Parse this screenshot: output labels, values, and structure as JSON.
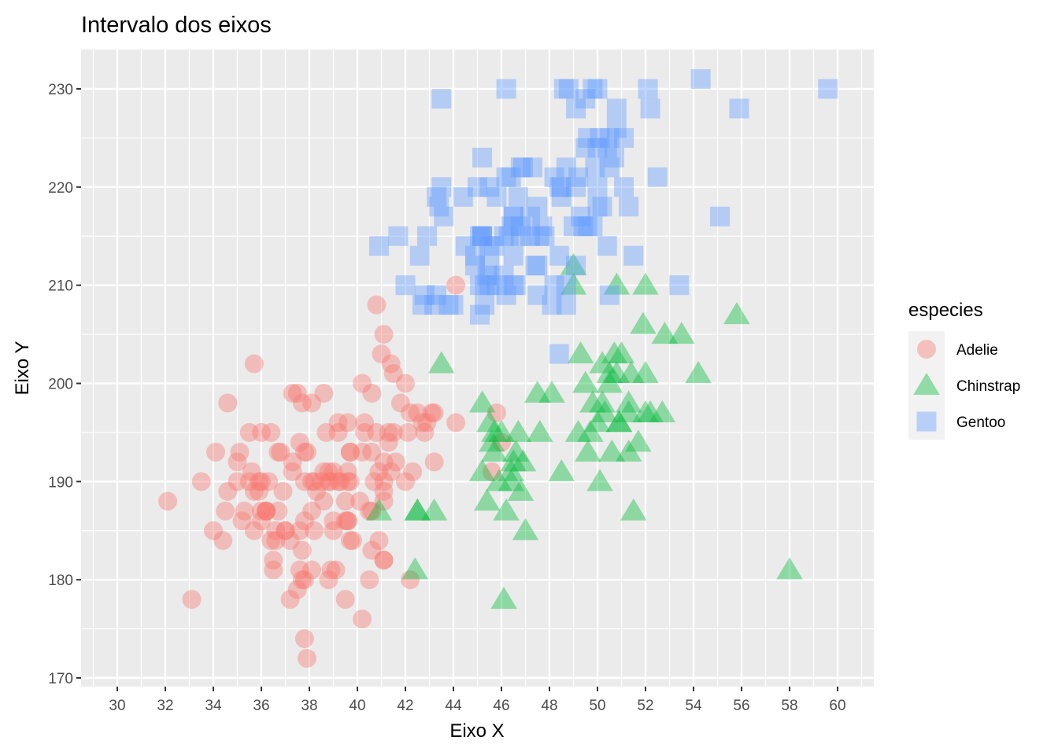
{
  "chart_data": {
    "type": "scatter",
    "title": "Intervalo dos eixos",
    "xlabel": "Eixo X",
    "ylabel": "Eixo Y",
    "xlim": [
      29,
      61
    ],
    "ylim": [
      169.4,
      234
    ],
    "x_ticks": [
      30,
      32,
      34,
      36,
      38,
      40,
      42,
      44,
      46,
      48,
      50,
      52,
      54,
      56,
      58,
      60
    ],
    "x_tick_labels": [
      "30",
      "32",
      "34",
      "36",
      "38",
      "40",
      "42",
      "44",
      "46",
      "48",
      "50",
      "52",
      "54",
      "56",
      "58",
      "60"
    ],
    "y_ticks": [
      170,
      180,
      190,
      200,
      210,
      220,
      230
    ],
    "y_tick_labels": [
      "170",
      "180",
      "190",
      "200",
      "210",
      "220",
      "230"
    ],
    "grid": true,
    "legend": {
      "title": "especies",
      "position": "right",
      "entries": [
        {
          "label": "Adelie",
          "shape": "circle",
          "color": "#F8766D"
        },
        {
          "label": "Chinstrap",
          "shape": "triangle",
          "color": "#00BA38"
        },
        {
          "label": "Gentoo",
          "shape": "square",
          "color": "#619CFF"
        }
      ]
    },
    "alpha": 0.4,
    "series": [
      {
        "name": "Adelie",
        "shape": "circle",
        "color": "#F8766D",
        "x": [
          39.1,
          39.5,
          40.3,
          36.7,
          39.3,
          38.9,
          39.2,
          34.1,
          42,
          37.8,
          37.8,
          41.1,
          38.6,
          34.6,
          36.6,
          38.7,
          42.5,
          34.4,
          46,
          37.8,
          37.7,
          35.9,
          38.2,
          38.8,
          35.3,
          40.6,
          40.5,
          37.9,
          40.5,
          39.5,
          37.2,
          39.5,
          40.9,
          36.4,
          39.2,
          38.8,
          42.2,
          37.6,
          39.8,
          36.5,
          40.8,
          36,
          44.1,
          37,
          39.6,
          41.1,
          37.5,
          36,
          42.3,
          39.6,
          40.1,
          35,
          42,
          34.5,
          41.4,
          39,
          40.6,
          36.5,
          37.6,
          35.7,
          41.3,
          37.6,
          41.1,
          36.4,
          41.6,
          35.5,
          41.1,
          35.9,
          41.8,
          33.5,
          39.7,
          39.6,
          45.8,
          35.5,
          42.8,
          40.9,
          37.2,
          36.2,
          42.1,
          34.6,
          42.9,
          36.7,
          35.1,
          37.3,
          41.3,
          36.3,
          36.9,
          38.3,
          38.9,
          35.7,
          41.1,
          34,
          39.6,
          36.2,
          40.8,
          38.1,
          40.3,
          33.1,
          43.2,
          35,
          41,
          37.7,
          37.8,
          37.9,
          39.7,
          38.6,
          38.2,
          38.1,
          43.2,
          38.1,
          45.6,
          39.7,
          42.2,
          39.6,
          42.7,
          38.6,
          37.3,
          35.7,
          41.1,
          36.2,
          37.7,
          40.2,
          41.4,
          35.2,
          40.6,
          38.8,
          41.5,
          39,
          44.1,
          38.5,
          43.1,
          36.8,
          37.5,
          38.1,
          41.1,
          35.6,
          40.2,
          37,
          39.7,
          40.2,
          40.6,
          32.1,
          40.7,
          37.3,
          39,
          39.2,
          36.6,
          36,
          37.8,
          36,
          41.5
        ],
        "y": [
          181,
          186,
          195,
          193,
          190,
          181,
          195,
          193,
          190,
          186,
          180,
          182,
          191,
          198,
          185,
          195,
          197,
          184,
          194,
          174,
          180,
          189,
          185,
          180,
          187,
          183,
          187,
          172,
          180,
          178,
          178,
          188,
          184,
          195,
          196,
          190,
          180,
          181,
          184,
          182,
          195,
          186,
          196,
          185,
          190,
          182,
          179,
          190,
          191,
          186,
          188,
          190,
          200,
          187,
          191,
          186,
          193,
          181,
          194,
          185,
          195,
          185,
          192,
          184,
          192,
          195,
          188,
          190,
          198,
          190,
          190,
          196,
          197,
          190,
          195,
          191,
          184,
          187,
          195,
          189,
          196,
          187,
          193,
          191,
          194,
          190,
          189,
          189,
          190,
          202,
          205,
          185,
          186,
          187,
          208,
          190,
          196,
          178,
          192,
          192,
          203,
          183,
          190,
          193,
          184,
          199,
          190,
          181,
          197,
          198,
          191,
          193,
          197,
          191,
          196,
          188,
          199,
          189,
          189,
          187,
          198,
          176,
          202,
          186,
          199,
          191,
          195,
          191,
          210,
          190,
          197,
          193,
          199,
          187,
          190,
          191,
          200,
          185,
          193,
          193,
          187,
          188,
          190,
          192,
          185,
          190,
          184,
          195,
          193,
          187,
          201
        ]
      },
      {
        "name": "Chinstrap",
        "shape": "triangle",
        "color": "#00BA38",
        "x": [
          46.5,
          50,
          51.3,
          45.4,
          52.7,
          45.2,
          46.1,
          51.3,
          46,
          51.3,
          46.6,
          51.7,
          47,
          52,
          45.9,
          50.5,
          50.3,
          58,
          46.4,
          49.2,
          42.4,
          48.5,
          43.2,
          50.6,
          46.7,
          52,
          50.5,
          49.5,
          46.4,
          52.8,
          40.9,
          54.2,
          42.5,
          51,
          49.7,
          47.5,
          47.6,
          52,
          46.9,
          53.5,
          49,
          46.2,
          50.9,
          45.5,
          50.9,
          50.8,
          50.1,
          49,
          51.5,
          49.8,
          48.1,
          51.4,
          45.7,
          50.7,
          42.5,
          52.2,
          45.2,
          49.3,
          50.2,
          45.6,
          51.9,
          46.8,
          45.7,
          55.8,
          43.5,
          49.6,
          50.8,
          50.2
        ],
        "y": [
          192,
          196,
          193,
          188,
          197,
          198,
          178,
          197,
          195,
          198,
          193,
          194,
          185,
          201,
          190,
          201,
          197,
          181,
          190,
          195,
          181,
          191,
          187,
          193,
          195,
          197,
          200,
          200,
          191,
          205,
          187,
          201,
          187,
          203,
          195,
          199,
          195,
          210,
          192,
          205,
          210,
          187,
          196,
          196,
          196,
          201,
          190,
          212,
          187,
          198,
          199,
          201,
          193,
          203,
          187,
          197,
          191,
          203,
          202,
          194,
          206,
          189,
          195,
          207,
          202,
          193,
          210,
          198
        ]
      },
      {
        "name": "Gentoo",
        "shape": "square",
        "color": "#619CFF",
        "x": [
          46.1,
          50,
          48.7,
          50,
          47.6,
          46.5,
          45.4,
          46.7,
          43.3,
          46.8,
          40.9,
          49,
          45.5,
          48.4,
          45.8,
          49.3,
          42,
          49.2,
          46.2,
          48.7,
          50.2,
          45.1,
          46.5,
          46.3,
          42.9,
          46.1,
          47.8,
          48.2,
          50,
          47.3,
          42.8,
          45.1,
          59.6,
          49.1,
          48.4,
          42.6,
          44.4,
          44,
          48.7,
          42.7,
          49.6,
          45.3,
          49.6,
          50.5,
          43.6,
          45.5,
          50.5,
          44.9,
          45.2,
          46.6,
          48.5,
          45.1,
          50.1,
          46.5,
          45,
          43.8,
          45.5,
          43.2,
          50.4,
          45.3,
          46.2,
          45.7,
          54.3,
          45.8,
          49.8,
          49.5,
          43.5,
          50.7,
          47.7,
          46.4,
          48.2,
          46.5,
          46.4,
          48.6,
          47.5,
          51.1,
          45.2,
          45.2,
          49.1,
          52.5,
          47.4,
          50,
          44.9,
          50.8,
          43.4,
          51.3,
          47.5,
          52.1,
          47.5,
          52.2,
          45.5,
          49.5,
          44.5,
          50.8,
          49.4,
          46.9,
          48.4,
          51.1,
          48.5,
          55.9,
          47.2,
          49.1,
          46.8,
          41.7,
          53.4,
          43.3,
          48.1,
          50.5,
          49.8,
          43.5,
          51.5,
          46.2,
          55.1,
          48.8,
          47.2,
          46.8,
          50.4,
          45.2,
          49.9
        ],
        "y": [
          211,
          230,
          210,
          218,
          215,
          210,
          211,
          219,
          209,
          215,
          214,
          216,
          214,
          213,
          210,
          217,
          210,
          221,
          209,
          222,
          218,
          215,
          213,
          215,
          215,
          215,
          215,
          210,
          220,
          222,
          209,
          207,
          230,
          220,
          220,
          213,
          219,
          208,
          208,
          208,
          225,
          210,
          216,
          222,
          217,
          210,
          225,
          213,
          215,
          210,
          220,
          210,
          225,
          217,
          220,
          208,
          220,
          208,
          224,
          208,
          221,
          214,
          231,
          219,
          230,
          229,
          220,
          223,
          216,
          221,
          221,
          217,
          216,
          230,
          209,
          220,
          215,
          223,
          212,
          221,
          212,
          224,
          212,
          228,
          218,
          218,
          212,
          230,
          218,
          228,
          212,
          224,
          214,
          226,
          216,
          222,
          203,
          225,
          219,
          228,
          215,
          228,
          216,
          215,
          210,
          219,
          208,
          209,
          216,
          229,
          213,
          230,
          217,
          230,
          217,
          222,
          214,
          215,
          222,
          212,
          213
        ]
      }
    ]
  }
}
